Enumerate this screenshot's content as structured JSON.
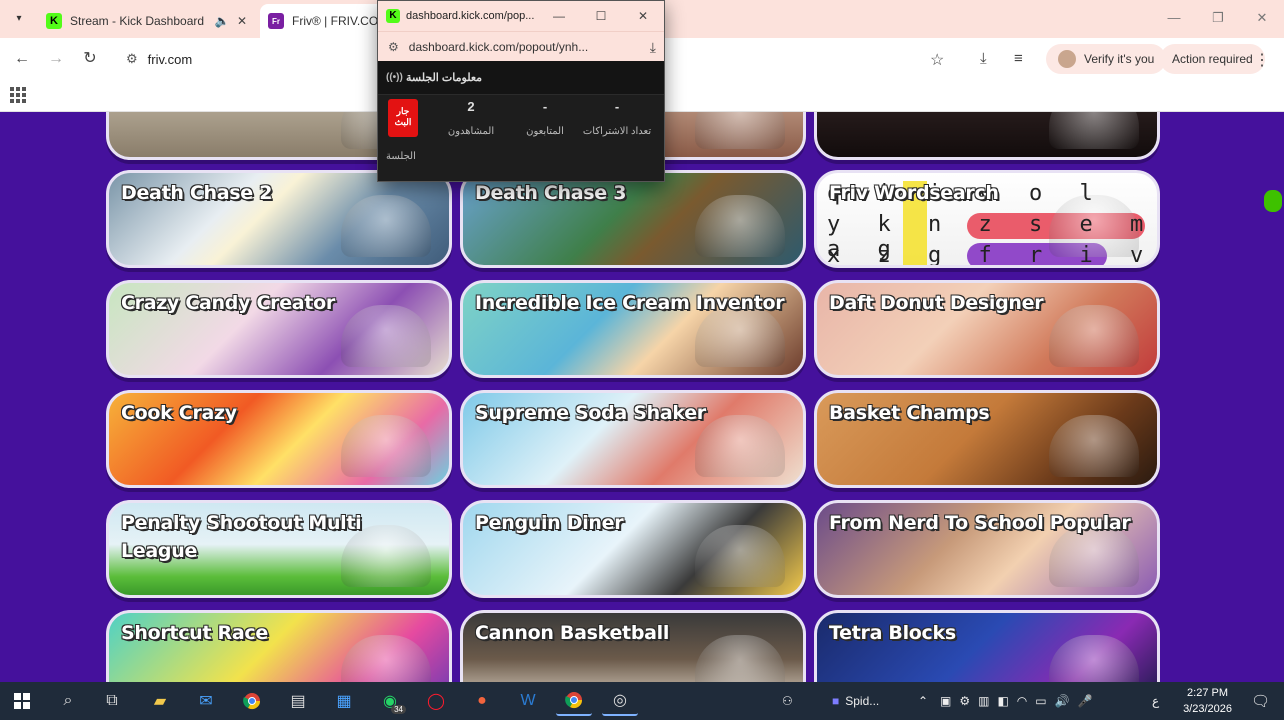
{
  "browser": {
    "tabs": [
      {
        "title": "Stream - Kick Dashboard",
        "favicon": "kick-icon",
        "icons": [
          "speaker-icon",
          "close-icon"
        ]
      },
      {
        "title": "Friv® | FRIV.COM",
        "favicon": "friv-icon"
      }
    ],
    "url": "friv.com",
    "verify_label": "Verify it's you",
    "action_label": "Action required"
  },
  "popout": {
    "title": "dashboard.kick.com/pop...",
    "url": "dashboard.kick.com/popout/ynh...",
    "header": "معلومات الجلسة",
    "live_badge": "جار البث",
    "session_label": "الجلسة",
    "stats": [
      {
        "value": "2",
        "label": "المشاهدون"
      },
      {
        "value": "-",
        "label": "المتابعون"
      },
      {
        "value": "-",
        "label": "تعداد الاشتراكات"
      }
    ]
  },
  "games": [
    {
      "title": "",
      "bg": "linear-gradient(180deg,#cfc6b3,#8a7d6a)"
    },
    {
      "title": "",
      "bg": "linear-gradient(180deg,#d9b8a3,#8a5b48)"
    },
    {
      "title": "",
      "bg": "linear-gradient(180deg,#3a2a2a,#120c0c)"
    },
    {
      "title": "Death Chase 2",
      "bg": "linear-gradient(135deg,#7a95a8 0%,#e8eef2 35%,#f9f2d6 45%,#6a8caa 70%,#3f5c7a 100%)"
    },
    {
      "title": "Death Chase 3",
      "bg": "linear-gradient(135deg,#6aa2cf 0%,#3f7f4a 45%,#7a5a2f 60%,#2d5a6e 100%)"
    },
    {
      "title": "Friv Wordsearch",
      "bg": "linear-gradient(180deg,#ffffff,#f1f1f1)"
    },
    {
      "title": "Crazy Candy Creator",
      "bg": "linear-gradient(135deg,#c7e6c0 0%,#f2d9e6 40%,#8c4fb3 70%,#e8e0d0 100%)"
    },
    {
      "title": "Incredible Ice Cream Inventor",
      "bg": "linear-gradient(135deg,#7fd3c5 0%,#5bb5d8 40%,#f6d4a8 60%,#6b3b2b 100%)"
    },
    {
      "title": "Daft Donut Designer",
      "bg": "linear-gradient(135deg,#e8b5a8 0%,#f3d0b8 40%,#d17a5b 70%,#c23b3b 100%)"
    },
    {
      "title": "Cook Crazy",
      "bg": "linear-gradient(135deg,#f6b23a 0%,#f15a24 35%,#ffe066 55%,#e86aa6 80%,#6dd0e0 100%)"
    },
    {
      "title": "Supreme Soda Shaker",
      "bg": "linear-gradient(135deg,#7ec9e8 0%,#dff1f8 40%,#e07a6a 65%,#efe0d0 100%)"
    },
    {
      "title": "Basket Champs",
      "bg": "linear-gradient(135deg,#d99a5a 0%,#c47a3a 45%,#6b3a1a 75%,#2a1a10 100%)"
    },
    {
      "title": "Penalty Shootout Multi League",
      "bg": "linear-gradient(180deg,#cfe8f2 0%,#e6f2f6 45%,#5bbd3a 80%,#3a9a2a 100%)"
    },
    {
      "title": "Penguin Diner",
      "bg": "linear-gradient(135deg,#9fd7ee 0%,#e8f4fa 45%,#3a3a3a 70%,#f2c94c 100%)"
    },
    {
      "title": "From Nerd To School Popular",
      "bg": "linear-gradient(135deg,#6b4b8a 0%,#c79a7a 40%,#f2d0b0 60%,#8a5ab3 100%)"
    },
    {
      "title": "Shortcut Race",
      "bg": "linear-gradient(135deg,#4fd1c5 0%,#f2e24c 45%,#e64aa0 75%,#6a3ab3 100%)"
    },
    {
      "title": "Cannon Basketball",
      "bg": "linear-gradient(180deg,#3a3a3a 0%,#6b5a4a 50%,#e0d6c8 100%)"
    },
    {
      "title": "Tetra Blocks",
      "bg": "linear-gradient(135deg,#1a2a6b 0%,#2a4ab3 45%,#8a2ab3 75%,#1a1a4a 100%)"
    }
  ],
  "wordsearch": {
    "rows": [
      "q i i v o l",
      "y k n z s e m a g",
      "x z g f r i v c e"
    ]
  },
  "taskbar": {
    "spider_label": "Spid...",
    "whatsapp_badge": "34",
    "time": "2:27 PM",
    "date": "3/23/2026",
    "lang": "ع"
  }
}
